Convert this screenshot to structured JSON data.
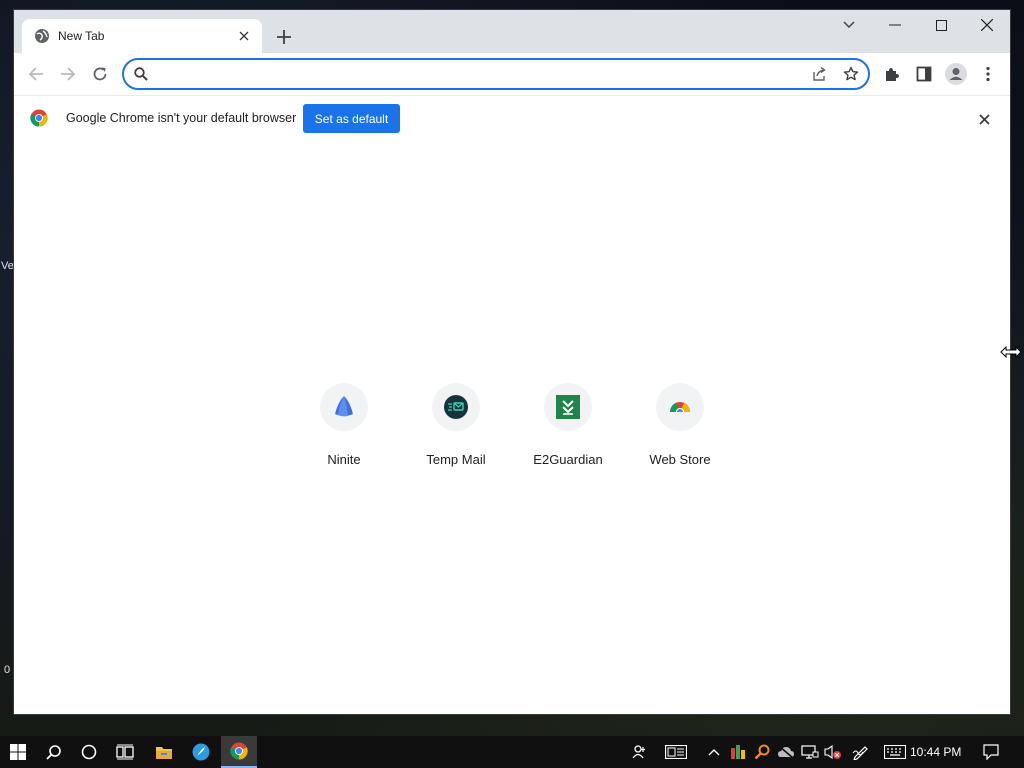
{
  "desktop": {
    "left_fragment": "Ve",
    "bottom_fragment": "0"
  },
  "browser": {
    "tab": {
      "title": "New Tab",
      "favicon": "globe-icon"
    },
    "omnibox": {
      "value": "",
      "placeholder": ""
    },
    "infobar": {
      "message": "Google Chrome isn't your default browser",
      "button_label": "Set as default"
    },
    "shortcuts": [
      {
        "label": "Ninite",
        "icon": "ninite-icon"
      },
      {
        "label": "Temp Mail",
        "icon": "temp-mail-icon"
      },
      {
        "label": "E2Guardian",
        "icon": "e2guardian-icon"
      },
      {
        "label": "Web Store",
        "icon": "web-store-icon"
      }
    ]
  },
  "taskbar": {
    "clock": "10:44 PM"
  },
  "colors": {
    "accent": "#1a73e8",
    "tabstrip": "#dee1e6",
    "taskbar": "#101010"
  }
}
